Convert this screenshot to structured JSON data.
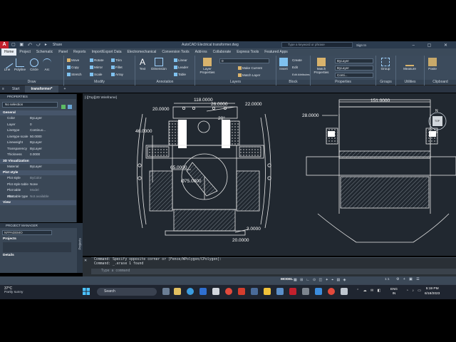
{
  "titlebar": {
    "app_title": "AutoCAD Electrical   transformer.dwg",
    "share_label": "Share",
    "search_placeholder": "Type a keyword or phrase",
    "signin_label": "Sign In"
  },
  "ribbon_tabs": [
    "Home",
    "Project",
    "Schematic",
    "Panel",
    "Reports",
    "Import/Export Data",
    "Electromechanical",
    "Conversion Tools",
    "Add-ins",
    "Collaborate",
    "Express Tools",
    "Featured Apps"
  ],
  "ribbon": {
    "draw": {
      "title": "Draw",
      "line": "Line",
      "polyline": "Polyline",
      "circle": "Circle",
      "arc": "Arc"
    },
    "modify": {
      "title": "Modify",
      "move": "Move",
      "rotate": "Rotate",
      "trim": "Trim",
      "copy": "Copy",
      "mirror": "Mirror",
      "fillet": "Fillet",
      "stretch": "Stretch",
      "scale": "Scale",
      "array": "Array"
    },
    "annotation": {
      "title": "Annotation",
      "text": "Text",
      "dimension": "Dimension",
      "linear": "Linear",
      "leader": "Leader",
      "table": "Table"
    },
    "layers": {
      "title": "Layers",
      "layer_properties": "Layer Properties",
      "layer_value": "0",
      "make_current": "Make Current",
      "match_layer": "Match Layer"
    },
    "block": {
      "title": "Block",
      "insert": "Insert",
      "create": "Create",
      "edit": "Edit",
      "edit_attributes": "Edit Attributes"
    },
    "properties": {
      "title": "Properties",
      "match_properties": "Match Properties",
      "bylayer1": "ByLayer",
      "bylayer2": "ByLayer",
      "conti": "Conti..."
    },
    "groups": {
      "title": "Groups",
      "group": "Group"
    },
    "utilities": {
      "title": "Utilities",
      "measure": "Measure"
    },
    "clipboard": {
      "title": "Clipboard",
      "paste": "Paste"
    }
  },
  "file_tabs": {
    "start": "Start",
    "active": "transformer*",
    "add": "+"
  },
  "properties_palette": {
    "header": "PROPERTIES",
    "selection": "No selection",
    "general": "General",
    "rows": [
      {
        "k": "Color",
        "v": "ByLayer"
      },
      {
        "k": "Layer",
        "v": "0"
      },
      {
        "k": "Linetype",
        "v": "Continuo..."
      },
      {
        "k": "Linetype scale",
        "v": "50.0000"
      },
      {
        "k": "Lineweight",
        "v": "ByLayer"
      },
      {
        "k": "Transparency",
        "v": "ByLayer"
      },
      {
        "k": "Thickness",
        "v": "0.0000"
      }
    ],
    "viz_header": "3D Visualization",
    "material": {
      "k": "Material",
      "v": "ByLayer"
    },
    "plot_header": "Plot style",
    "plot_rows": [
      {
        "k": "Plot style",
        "v": "ByColor"
      },
      {
        "k": "Plot style table",
        "v": "None"
      },
      {
        "k": "Plot table attac...",
        "v": "Model"
      },
      {
        "k": "Plot table type",
        "v": "Not available"
      }
    ],
    "view_header": "View"
  },
  "project_manager": {
    "header": "PROJECT MANAGER",
    "project": "NFPADEMO",
    "projects_label": "Projects",
    "details_label": "Details",
    "side_tab": "Projects"
  },
  "viewport_label": "[-][Top][2D Wireframe]",
  "dimensions": {
    "d118": "118.0000",
    "d20a": "20.0000",
    "d26": "26.0000",
    "d22": "22.0000",
    "d46": "46.0000",
    "d20deg": "20°",
    "d65": "65.0000",
    "d75": "Ø75.0000",
    "d3": "3.0000",
    "d20b": "20.0000",
    "d151": "151.0000",
    "d28": "28.0000"
  },
  "viewcube": {
    "n": "N",
    "s": "S",
    "top": "TOP"
  },
  "command_line": {
    "line1": "Command: Specify opposite corner or [Fence/WPolygon/CPolygon]:",
    "line2": "Command: _.erase 1 found",
    "placeholder": "Type a command"
  },
  "status_bar": {
    "model": "MODEL",
    "scale": "1:1"
  },
  "taskbar": {
    "temperature": "37°C",
    "weather": "Partly sunny",
    "search": "Search",
    "lang1": "ENG",
    "lang2": "IN",
    "time": "5:19 PM",
    "date": "6/18/2023"
  }
}
